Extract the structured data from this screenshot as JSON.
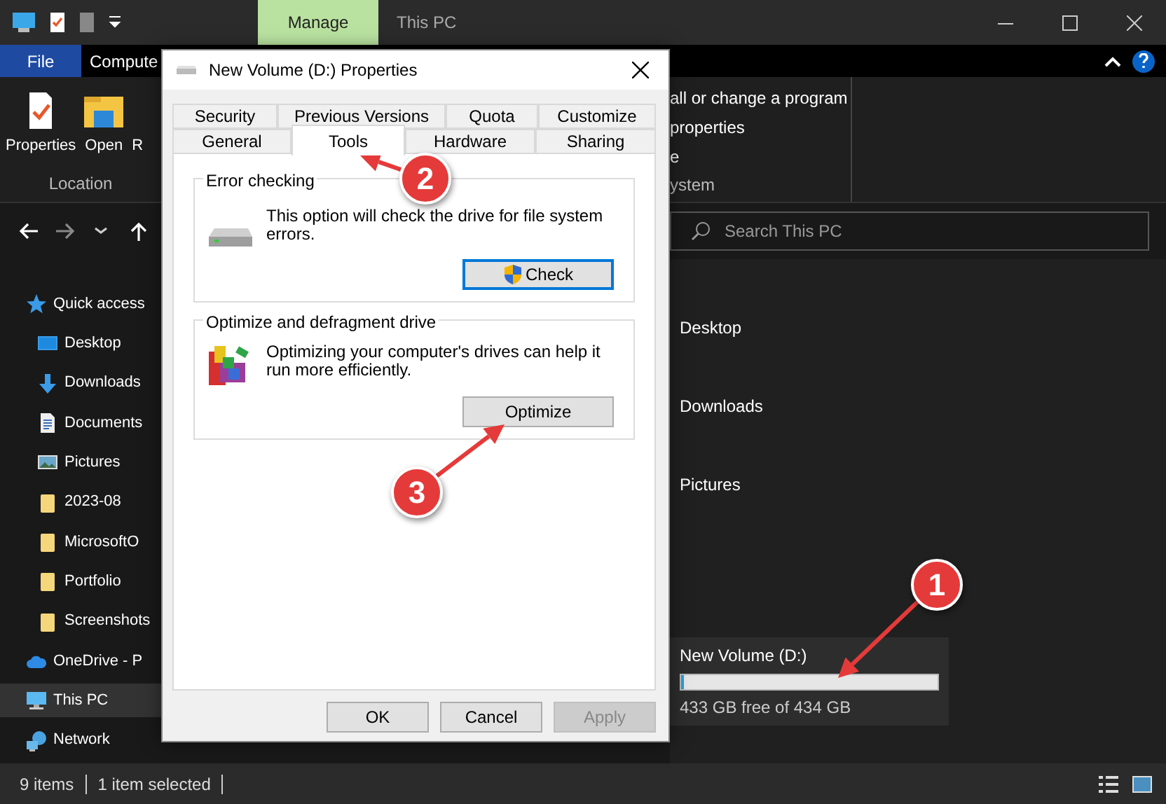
{
  "title_bar": {
    "context_tab": "Manage",
    "title": "This PC"
  },
  "ribbon": {
    "tabs": [
      {
        "label": "File",
        "kind": "file"
      },
      {
        "label": "Compute",
        "kind": "tab"
      }
    ],
    "commands": [
      {
        "label": "Properties",
        "kind": "properties"
      },
      {
        "label": "Open",
        "kind": "open"
      },
      {
        "label": "R",
        "kind": "partial"
      }
    ],
    "group_label": "Location",
    "system_commands": [
      "all or change a program",
      "properties",
      "e"
    ],
    "system_group_label": "ystem"
  },
  "address_bar": {
    "search_placeholder": "Search This PC"
  },
  "navigation": {
    "items": [
      {
        "label": "Quick access",
        "kind": "star",
        "selected": false,
        "children": [
          {
            "label": "Desktop",
            "kind": "desktop",
            "selected": false
          },
          {
            "label": "Downloads",
            "kind": "download",
            "selected": false
          },
          {
            "label": "Documents",
            "kind": "document",
            "selected": false
          },
          {
            "label": "Pictures",
            "kind": "picture",
            "selected": false
          },
          {
            "label": "2023-08",
            "kind": "folder",
            "selected": false
          },
          {
            "label": "MicrosoftO",
            "kind": "folder",
            "selected": false
          },
          {
            "label": "Portfolio",
            "kind": "folder",
            "selected": false
          },
          {
            "label": "Screenshots",
            "kind": "folder",
            "selected": false
          }
        ]
      },
      {
        "label": "OneDrive - P",
        "kind": "cloud",
        "selected": false
      },
      {
        "label": "This PC",
        "kind": "pc",
        "selected": true
      },
      {
        "label": "Network",
        "kind": "network",
        "selected": false
      }
    ]
  },
  "content": {
    "folders": [
      "Desktop",
      "Downloads",
      "Pictures"
    ],
    "drive": {
      "name": "New Volume (D:)",
      "level": 0.01,
      "free_text": "433 GB free of 434 GB"
    }
  },
  "status_bar": {
    "item_count": "9 items",
    "selection": "1 item selected"
  },
  "dialog": {
    "title": "New Volume (D:) Properties",
    "tab_rows": [
      [
        {
          "label": "Security",
          "selected": false
        },
        {
          "label": "Previous Versions",
          "selected": false
        },
        {
          "label": "Quota",
          "selected": false
        },
        {
          "label": "Customize",
          "selected": false
        }
      ],
      [
        {
          "label": "General",
          "selected": false
        },
        {
          "label": "Tools",
          "selected": true
        },
        {
          "label": "Hardware",
          "selected": false
        },
        {
          "label": "Sharing",
          "selected": false
        }
      ]
    ],
    "groups": [
      {
        "title": "Error checking",
        "kind": "check",
        "text": "This option will check the drive for file system errors.",
        "button": "Check"
      },
      {
        "title": "Optimize and defragment drive",
        "kind": "defrag",
        "text": "Optimizing your computer's drives can help it run more efficiently.",
        "button": "Optimize"
      }
    ],
    "buttons": [
      {
        "label": "OK",
        "disabled": false
      },
      {
        "label": "Cancel",
        "disabled": false
      },
      {
        "label": "Apply",
        "disabled": true
      }
    ]
  },
  "annotations": [
    {
      "number": "1"
    },
    {
      "number": "2"
    },
    {
      "number": "3"
    }
  ]
}
